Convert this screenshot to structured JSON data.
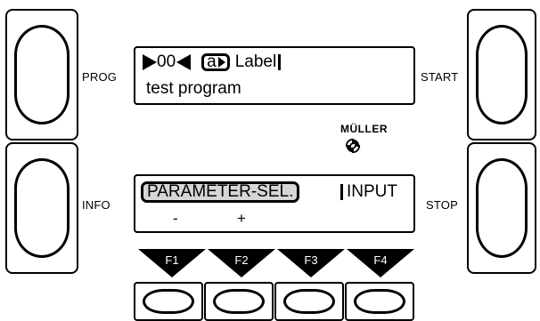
{
  "side_buttons": {
    "prog": "PROG",
    "info": "INFO",
    "start": "START",
    "stop": "STOP"
  },
  "display_top": {
    "program_number": "00",
    "cursor_char": "a",
    "field_label": "Label",
    "program_name": "test program"
  },
  "display_bottom": {
    "parameter_select": "PARAMETER-SEL.",
    "input": "INPUT",
    "minus": "-",
    "plus": "+"
  },
  "function_keys": [
    "F1",
    "F2",
    "F3",
    "F4"
  ],
  "brand": {
    "name": "MÜLLER",
    "logo_icon": "swirl-logo-icon"
  }
}
